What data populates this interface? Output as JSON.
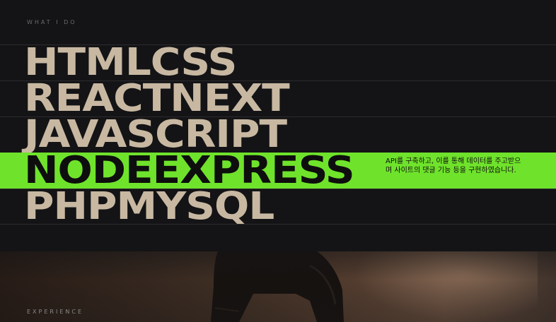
{
  "what_i_do": {
    "label": "WHAT I DO"
  },
  "skills": [
    {
      "title": "HTMLCSS",
      "active": false,
      "description": ""
    },
    {
      "title": "REACTNEXT",
      "active": false,
      "description": ""
    },
    {
      "title": "JAVASCRIPT",
      "active": false,
      "description": ""
    },
    {
      "title": "NODEEXPRESS",
      "active": true,
      "description": "API를 구축하고, 이를 통해 데이터를 주고받으며 사이트의 댓글 기능 등을 구현하였습니다."
    },
    {
      "title": "PHPMYSQL",
      "active": false,
      "description": ""
    }
  ],
  "experience": {
    "label": "EXPERIENCE"
  },
  "colors": {
    "background": "#141416",
    "accent": "#6fe32b",
    "headline": "#c8b8a2"
  }
}
